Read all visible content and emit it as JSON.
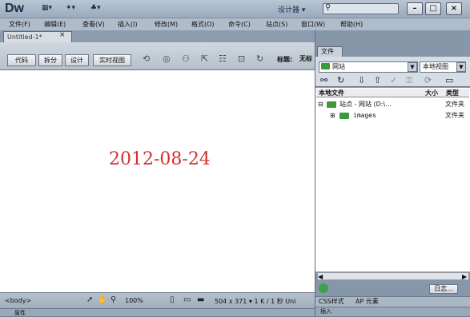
{
  "app": {
    "logo": "Dw",
    "workspace": "设计器 ▾",
    "window_buttons": [
      "–",
      "□",
      "×"
    ]
  },
  "menubar": [
    "文件(F)",
    "编辑(E)",
    "查看(V)",
    "插入(I)",
    "修改(M)",
    "格式(O)",
    "命令(C)",
    "站点(S)",
    "窗口(W)",
    "帮助(H)"
  ],
  "document": {
    "tab_label": "Untitled-1*",
    "tab_close": "×",
    "view_buttons": [
      "代码",
      "拆分",
      "设计",
      "实时视图"
    ],
    "title_label": "标题:",
    "title_value": "无标",
    "canvas_text": "2012-08-24"
  },
  "statusbar": {
    "tag": "<body>",
    "zoom": "100%",
    "dims": "504 x 371 ▾  1 K / 1 秒  Uni"
  },
  "properties_label": "属性",
  "panel": {
    "tab": "文件",
    "site_select": "网站",
    "view_select": "本地视图",
    "headers": [
      "本地文件",
      "大小",
      "类型"
    ],
    "rows": [
      {
        "name": "站点 - 网站 (D:\\...",
        "type": "文件夹"
      },
      {
        "name": "images",
        "type": "文件夹"
      }
    ],
    "log_button": "日志...",
    "css_tab": "CSS样式",
    "ap_tab": "AP 元素",
    "insert_label": "插入"
  }
}
